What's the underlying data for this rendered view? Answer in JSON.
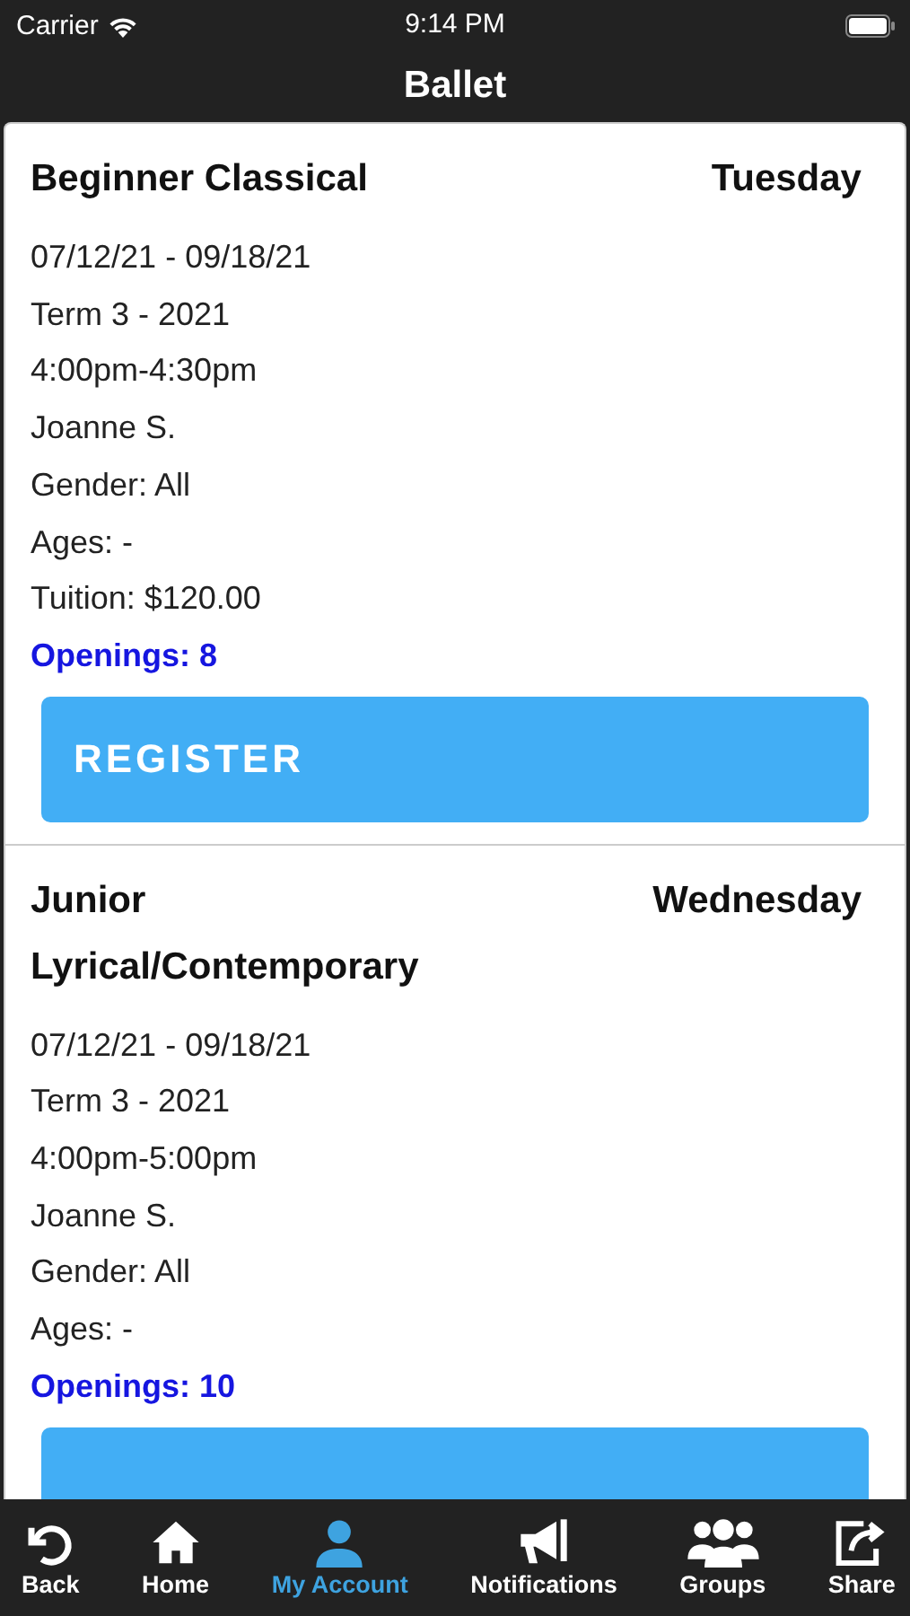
{
  "status_bar": {
    "carrier": "Carrier",
    "time": "9:14 PM"
  },
  "nav": {
    "title": "Ballet"
  },
  "classes": [
    {
      "name": "Beginner Classical",
      "day": "Tuesday",
      "details": [
        "07/12/21 - 09/18/21",
        "Term 3 - 2021",
        "4:00pm-4:30pm",
        "Joanne S.",
        "Gender: All",
        "Ages: -",
        "Tuition: $120.00"
      ],
      "openings": "Openings: 8",
      "register_button": true,
      "register_label": "REGISTER"
    },
    {
      "name": "Junior Lyrical/Contemporary",
      "day": "Wednesday",
      "details": [
        "07/12/21 - 09/18/21",
        "Term 3 - 2021",
        "4:00pm-5:00pm",
        "Joanne S.",
        "Gender: All",
        "Ages: -"
      ],
      "openings": "Openings: 10",
      "register_button": true
    }
  ],
  "tab_bar": [
    {
      "label": "Back",
      "kind": "back",
      "selected": false
    },
    {
      "label": "Home",
      "kind": "home",
      "selected": false
    },
    {
      "label": "My Account",
      "kind": "account",
      "selected": true
    },
    {
      "label": "Notifications",
      "kind": "megaphone",
      "selected": false
    },
    {
      "label": "Groups",
      "kind": "groups",
      "selected": false
    },
    {
      "label": "Share",
      "kind": "share",
      "selected": false
    }
  ]
}
